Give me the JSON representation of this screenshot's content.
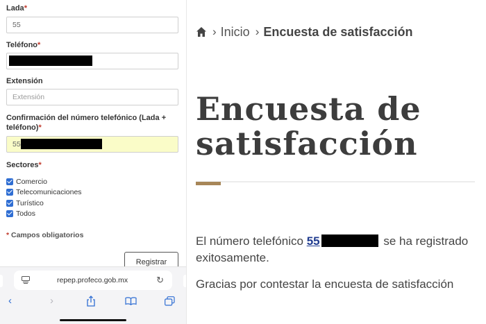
{
  "form": {
    "lada": {
      "label": "Lada",
      "required_mark": "*",
      "value": "55"
    },
    "telefono": {
      "label": "Teléfono",
      "required_mark": "*"
    },
    "extension": {
      "label": "Extensión",
      "placeholder": "Extensión"
    },
    "confirmacion": {
      "label_line1": "Confirmación del número telefónico (Lada +",
      "label_line2": "teléfono)",
      "required_mark": "*",
      "value": "55"
    },
    "sectores": {
      "label": "Sectores",
      "required_mark": "*",
      "items": [
        "Comercio",
        "Telecomunicaciones",
        "Turístico",
        "Todos"
      ]
    },
    "required_note_mark": "*",
    "required_note": " Campos obligatorios",
    "submit_label": "Registrar"
  },
  "browser": {
    "url": "repep.profeco.gob.mx",
    "icons": [
      "reader-icon",
      "reload-icon",
      "back-icon",
      "forward-icon",
      "share-icon",
      "bookmarks-icon",
      "tabs-icon"
    ]
  },
  "page": {
    "breadcrumb": {
      "home": "Inicio",
      "current": "Encuesta de satisfacción"
    },
    "title": "Encuesta de satisfacción",
    "message_prefix": "El número telefónico ",
    "message_number": "55",
    "message_suffix": " se ha registrado exitosamente.",
    "thanks": "Gracias por contestar la encuesta de satisfacción"
  },
  "colors": {
    "accent": "#a78658",
    "checkbox": "#2f6ed3",
    "link": "#1f3b8f",
    "highlight_field": "#fafcc8",
    "required": "#c0392b"
  }
}
